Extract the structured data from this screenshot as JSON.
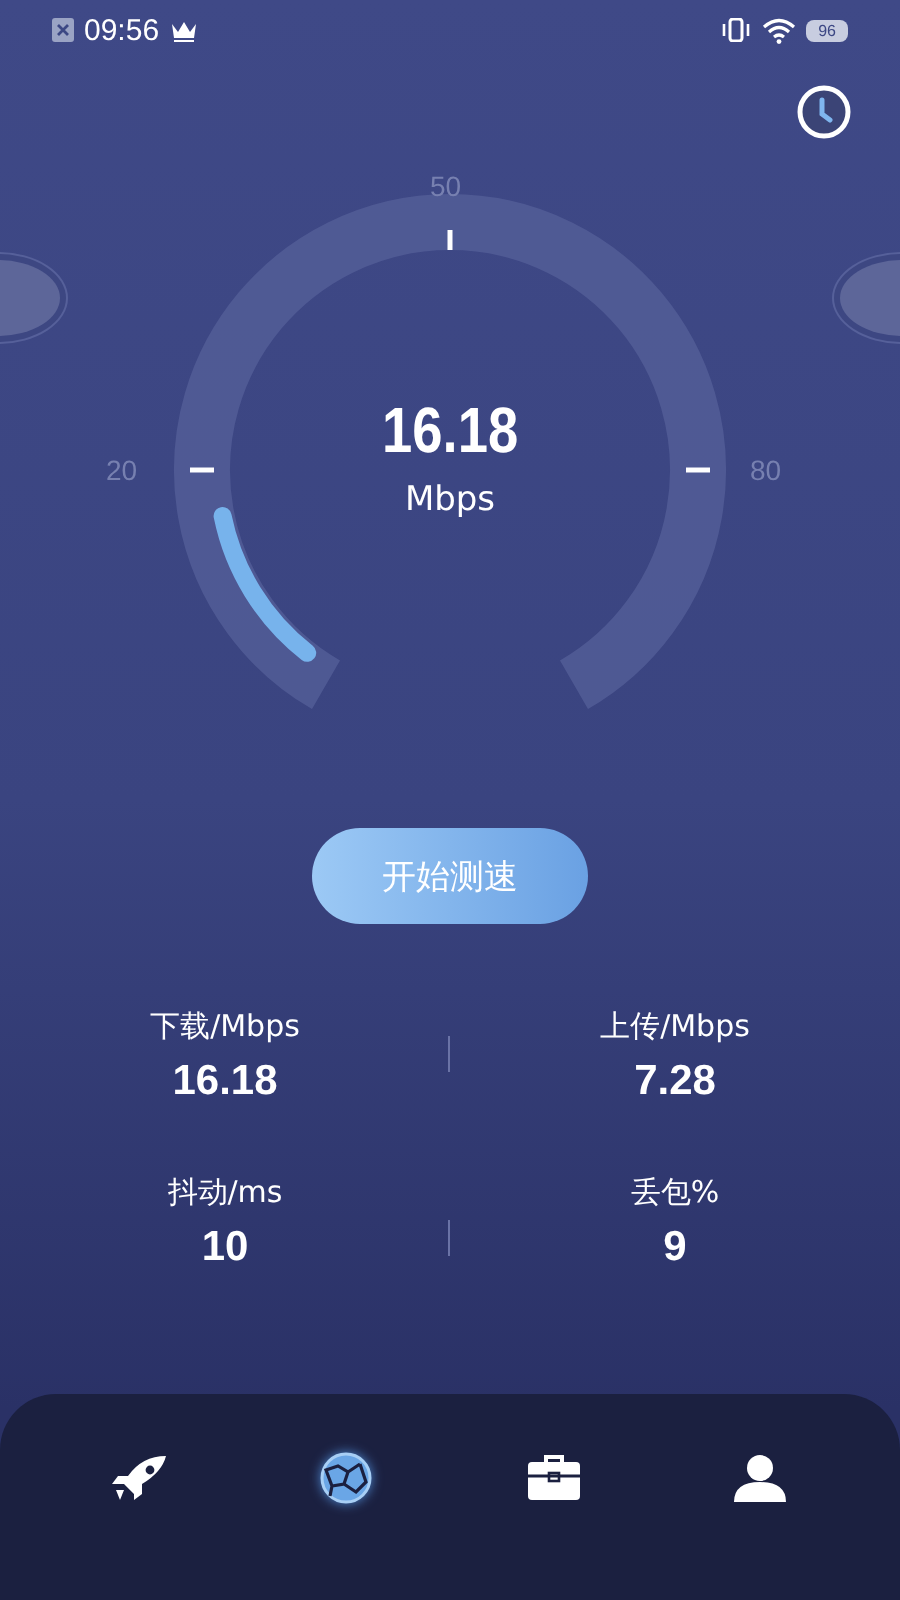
{
  "status_bar": {
    "time": "09:56",
    "battery": "96"
  },
  "gauge": {
    "value": "16.18",
    "unit": "Mbps",
    "level": 0.1618,
    "ticks": [
      {
        "label": "20",
        "kind": "left"
      },
      {
        "label": "50",
        "kind": "top"
      },
      {
        "label": "80",
        "kind": "right"
      }
    ]
  },
  "start_button": "开始测速",
  "stats": [
    {
      "label": "下载/Mbps",
      "value": "16.18"
    },
    {
      "label": "上传/Mbps",
      "value": "7.28"
    },
    {
      "label": "抖动/ms",
      "value": "10"
    },
    {
      "label": "丢包%",
      "value": "9"
    }
  ],
  "nav": [
    {
      "kind": "rocket",
      "selected": false
    },
    {
      "kind": "globe",
      "selected": true
    },
    {
      "kind": "briefcase",
      "selected": false
    },
    {
      "kind": "person",
      "selected": false
    }
  ]
}
